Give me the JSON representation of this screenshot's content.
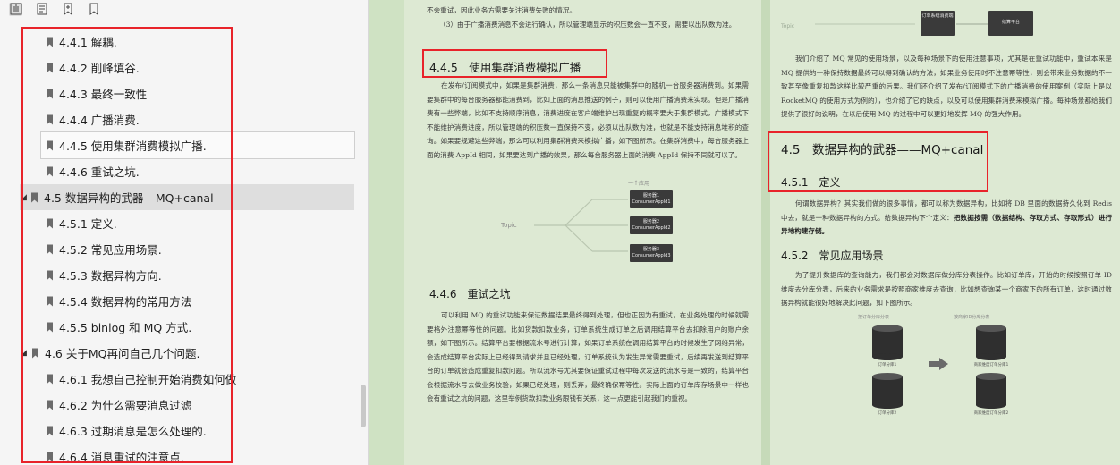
{
  "sidebar": {
    "toolbar": [
      "thumbnails-icon",
      "outline-icon",
      "bookmark-add-icon",
      "bookmark-icon"
    ],
    "items": [
      {
        "label": "4.4.1 解耦."
      },
      {
        "label": "4.4.2 削峰填谷."
      },
      {
        "label": "4.4.3 最终一致性"
      },
      {
        "label": "4.4.4 广播消费."
      },
      {
        "label": "4.4.5 使用集群消费模拟广播."
      },
      {
        "label": "4.4.6 重试之坑."
      },
      {
        "label": "4.5 数据异构的武器---MQ+canal"
      },
      {
        "label": "4.5.1 定义."
      },
      {
        "label": "4.5.2 常见应用场景."
      },
      {
        "label": "4.5.3 数据异构方向."
      },
      {
        "label": "4.5.4 数据异构的常用方法"
      },
      {
        "label": "4.5.5 binlog 和 MQ 方式."
      },
      {
        "label": "4.6 关于MQ再问自己几个问题."
      },
      {
        "label": "4.6.1 我想自己控制开始消费如何做"
      },
      {
        "label": "4.6.2 为什么需要消息过滤"
      },
      {
        "label": "4.6.3 过期消息是怎么处理的."
      },
      {
        "label": "4.6.4 消息重试的注意点."
      }
    ]
  },
  "left_page": {
    "top_line1": "不会重试，因此业务方需要关注消费失败的情况。",
    "top_line2": "（3）由于广播消费消息不会进行确认，所以管理端显示的积压数会一直不变，需要以出队数为准。",
    "sec_445_title": "4.4.5　使用集群消费模拟广播",
    "sec_445_body": "在发布/订阅模式中，如果是集群消费，那么一条消息只能被集群中的随机一台服务器消费到。如果需要集群中的每台服务器都能消费到，比如上面的消息推送的例子，则可以使用广播消费来实现。但是广播消费有一些弊端，比如不支持顺序消息，消费进度在客户端维护出现重复的概率要大于集群模式，广播模式下不能维护消费进度，所以管理端的积压数一直保持不变，必须以出队数为准，也就是不能支持消息堆积的查询。如果要规避这些弊端，那么可以利用集群消费来模拟广播，如下图所示。在集群消费中，每台服务器上面的消费 AppId 相同，如果要达到广播的效果，那么每台服务器上面的消费 AppId 保持不同就可以了。",
    "diagram_title": "一个应用",
    "diagram_topic": "Topic",
    "diagram_server1": "服务器1",
    "diagram_server2": "服务器2",
    "diagram_server3": "服务器3",
    "diagram_consumer1": "ConsumerAppId1",
    "diagram_consumer2": "ConsumerAppId2",
    "diagram_consumer3": "ConsumerAppId3",
    "sec_446_title": "4.4.6　重试之坑",
    "sec_446_body": "可以利用 MQ 的重试功能来保证数据结果最终得到处理，但也正因为有重试，在业务处理的时候就需要格外注意幂等性的问题。比如货款扣款业务，订单系统生成订单之后调用结算平台去扣除用户的账户余额，如下图所示。结算平台要根据流水号进行计算，如果订单系统在调用结算平台的时候发生了网络异常，会造成结算平台实际上已经得到请求并且已经处理，订单系统认为发生异常需要重试，后续再发送到结算平台的订单就会造成重复扣款问题。所以流水号尤其要保证重试过程中每次发送的流水号是一致的，结算平台会根据流水号去做业务校验，如果已经处理，则丢弃，最终确保幂等性。实际上面的订单库存场景中一样也会有重试之坑的问题，这里举例货款扣款业务跟钱有关系，这一点更能引起我们的重视。"
  },
  "right_page": {
    "top_diagram_topic": "Topic",
    "top_diagram_box1": "订单系统消费端",
    "top_diagram_box2": "结算平台",
    "intro_body": "我们介绍了 MQ 常见的使用场景，以及每种场景下的使用注意事项，尤其是在重试功能中，重试本来是 MQ 提供的一种保持数据最终可以得到确认的方法，如果业务使用时不注意幂等性，则会带来业务数据的不一致甚至像重复扣款这样比较严重的后果。我们还介绍了发布/订阅模式下的广播消费的使用案例（实际上是以 RocketMQ 的使用方式为例的），也介绍了它的缺点，以及可以使用集群消费来模拟广播。每种场景都给我们提供了很好的说明，在以后使用 MQ 的过程中可以更好地发挥 MQ 的强大作用。",
    "sec_45_title": "4.5　数据异构的武器——MQ+canal",
    "sec_451_title": "4.5.1　定义",
    "sec_451_body_plain": "何谓数据异构？其实我们做的很多事情，都可以称为数据异构，比如将 DB 里面的数据持久化到 Redis 中去，就是一种数据异构的方式。给数据异构下个定义：",
    "sec_451_body_bold": "把数据按需（数据结构、存取方式、存取形式）进行异地构建存储。",
    "sec_452_title": "4.5.2　常见应用场景",
    "sec_452_body": "为了提升数据库的查询能力，我们都会对数据库做分库分表操作。比如订单库，开始的时候按照订单 ID 维度去分库分表，后来的业务需求是按照商家维度去查询，比如想查询某一个商家下的所有订单，这时通过数据异构就能很好地解决此问题，如下图所示。",
    "diagram_left_title": "按订单分库分表",
    "diagram_right_title": "按商家ID分库分表",
    "diagram_db_left1": "订单分库1",
    "diagram_db_left2": "订单分库2",
    "diagram_db_right1": "商家维度订单分库1",
    "diagram_db_right2": "商家维度订单分库2"
  },
  "colors": {
    "highlight_red": "#e8232a",
    "page_bg": "#dde9d3",
    "viewer_bg": "#cfe2c3",
    "sidebar_bg": "#f5f5f5"
  }
}
